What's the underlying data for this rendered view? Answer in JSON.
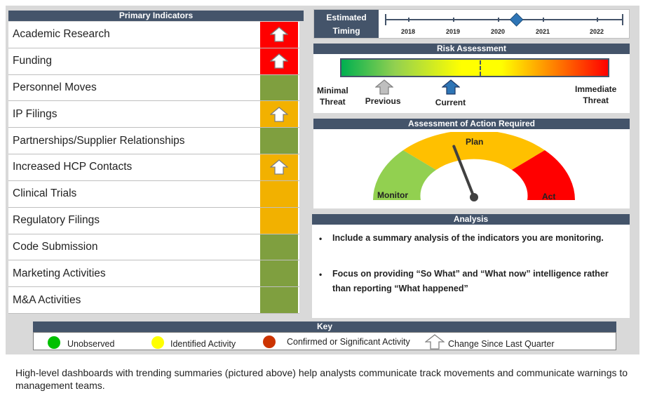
{
  "primary_indicators": {
    "title": "Primary Indicators",
    "rows": [
      {
        "label": "Academic Research",
        "status_color": "#ff0000",
        "change_arrow": true
      },
      {
        "label": "Funding",
        "status_color": "#ff0000",
        "change_arrow": true
      },
      {
        "label": "Personnel Moves",
        "status_color": "#7f9f3f",
        "change_arrow": false
      },
      {
        "label": "IP Filings",
        "status_color": "#f2b100",
        "change_arrow": true
      },
      {
        "label": "Partnerships/Supplier Relationships",
        "status_color": "#7f9f3f",
        "change_arrow": false
      },
      {
        "label": "Increased HCP Contacts",
        "status_color": "#f2b100",
        "change_arrow": true
      },
      {
        "label": "Clinical Trials",
        "status_color": "#f2b100",
        "change_arrow": false
      },
      {
        "label": "Regulatory Filings",
        "status_color": "#f2b100",
        "change_arrow": false
      },
      {
        "label": "Code Submission",
        "status_color": "#7f9f3f",
        "change_arrow": false
      },
      {
        "label": "Marketing Activities",
        "status_color": "#7f9f3f",
        "change_arrow": false
      },
      {
        "label": "M&A Activities",
        "status_color": "#7f9f3f",
        "change_arrow": false
      }
    ]
  },
  "timing": {
    "label_line1": "Estimated",
    "label_line2": "Timing",
    "years": [
      "2018",
      "2019",
      "2020",
      "2021",
      "2022"
    ],
    "marker_year": 2020.4
  },
  "risk": {
    "title": "Risk Assessment",
    "left_label_line1": "Minimal",
    "left_label_line2": "Threat",
    "right_label_line1": "Immediate",
    "right_label_line2": "Threat",
    "previous_label": "Previous",
    "current_label": "Current",
    "previous_position": 0.16,
    "current_position": 0.41
  },
  "assessment": {
    "title": "Assessment of Action Required",
    "monitor_label": "Monitor",
    "plan_label": "Plan",
    "act_label": "Act",
    "needle_position": 0.38
  },
  "analysis": {
    "title": "Analysis",
    "bullets": [
      "Include a summary analysis of the indicators you are monitoring.",
      "Focus on providing “So What” and “What now” intelligence rather than reporting “What happened”"
    ]
  },
  "key": {
    "title": "Key",
    "unobserved": "Unobserved",
    "identified": "Identified Activity",
    "confirmed": "Confirmed or Significant Activity",
    "change": "Change Since Last Quarter",
    "colors": {
      "unobserved": "#00c000",
      "identified": "#ffff00",
      "confirmed": "#cc3300"
    }
  },
  "caption": "High-level dashboards with trending summaries (pictured above) help analysts communicate track movements  and communicate warnings to management teams."
}
